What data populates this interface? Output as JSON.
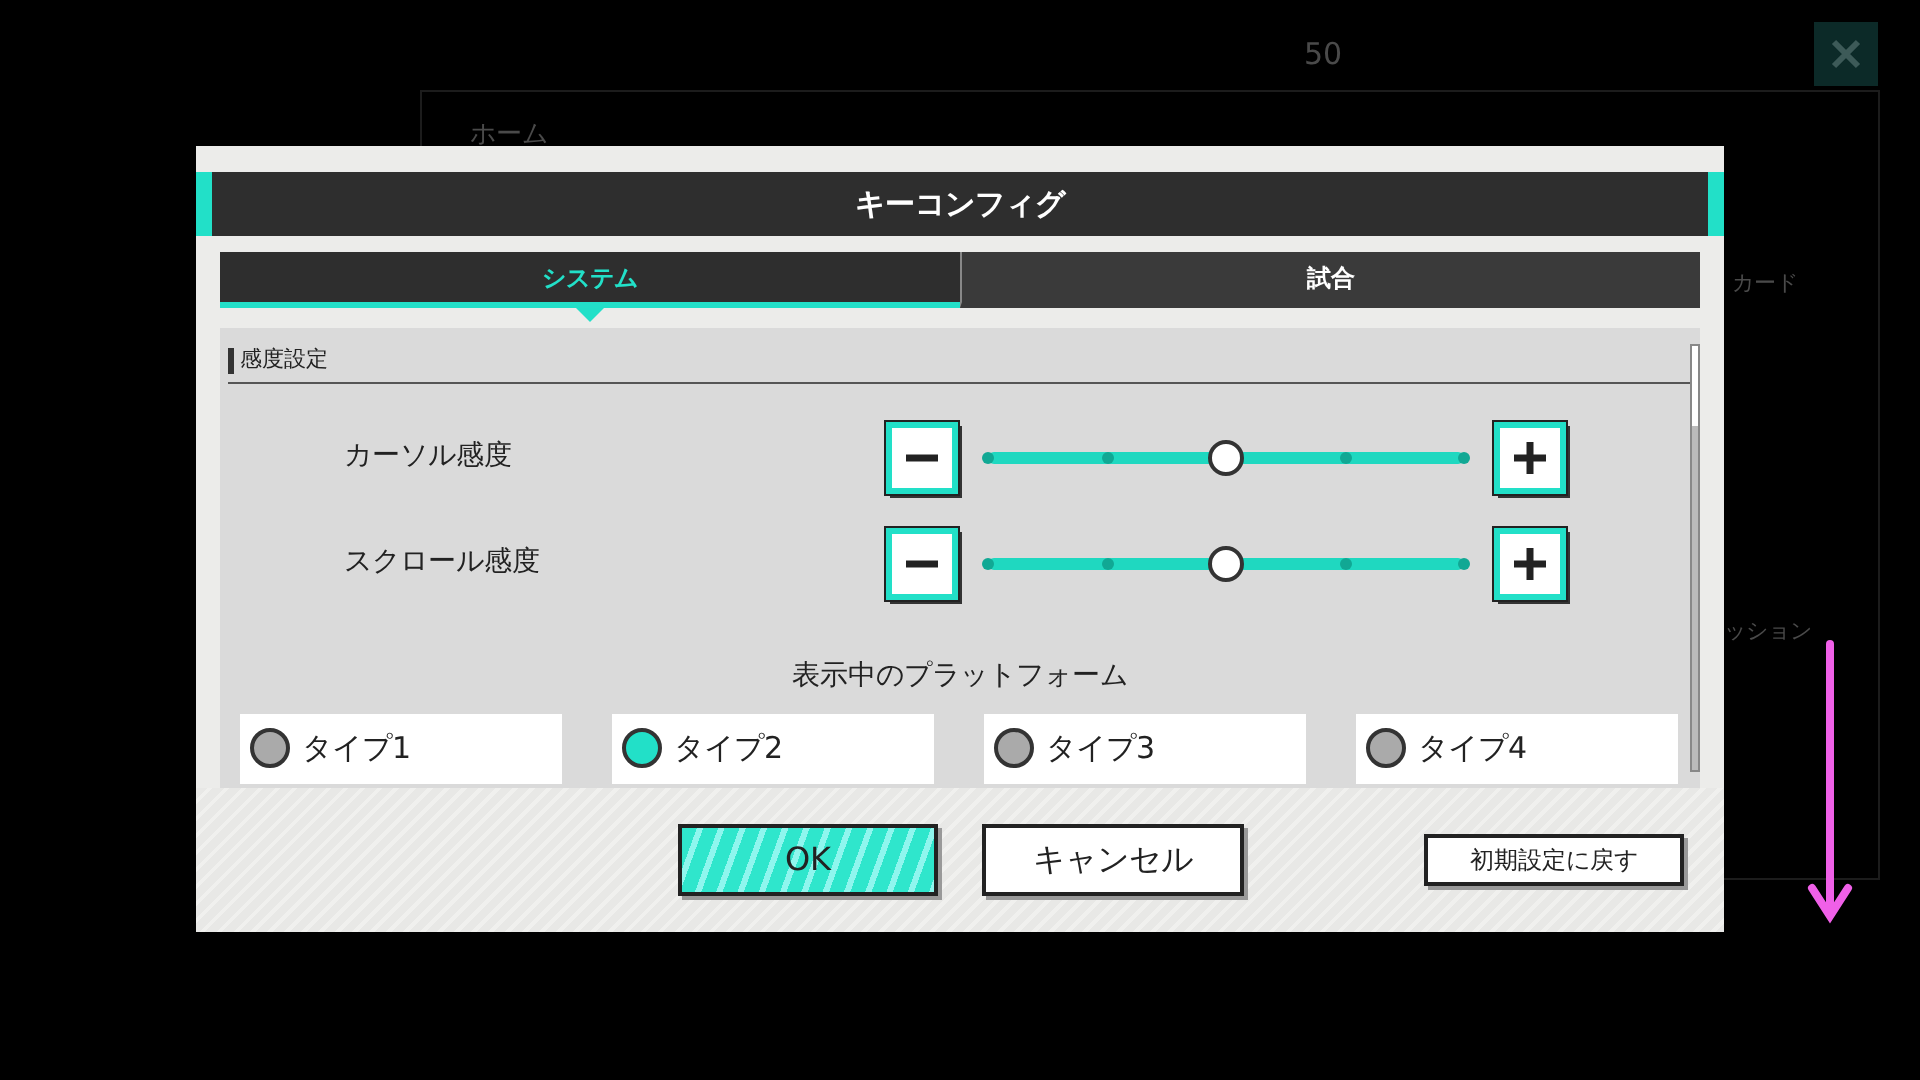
{
  "background": {
    "count": "50",
    "section_title": "ホーム",
    "side_items": [
      "カード",
      "ッション"
    ]
  },
  "dialog": {
    "title": "キーコンフィグ",
    "tabs": [
      {
        "label": "システム",
        "selected": true
      },
      {
        "label": "試合",
        "selected": false
      }
    ],
    "section": "感度設定",
    "sliders": [
      {
        "label": "カーソル感度",
        "level": 0.5
      },
      {
        "label": "スクロール感度",
        "level": 0.5
      }
    ],
    "platform_heading": "表示中のプラットフォーム",
    "platforms": [
      {
        "label": "タイプ1",
        "selected": false
      },
      {
        "label": "タイプ2",
        "selected": true
      },
      {
        "label": "タイプ3",
        "selected": false
      },
      {
        "label": "タイプ4",
        "selected": false
      }
    ],
    "buttons": [
      {
        "label": "OK",
        "kind": "primary"
      },
      {
        "label": "キャンセル",
        "kind": "secondary"
      },
      {
        "label": "初期設定に戻す",
        "kind": "small"
      }
    ]
  }
}
